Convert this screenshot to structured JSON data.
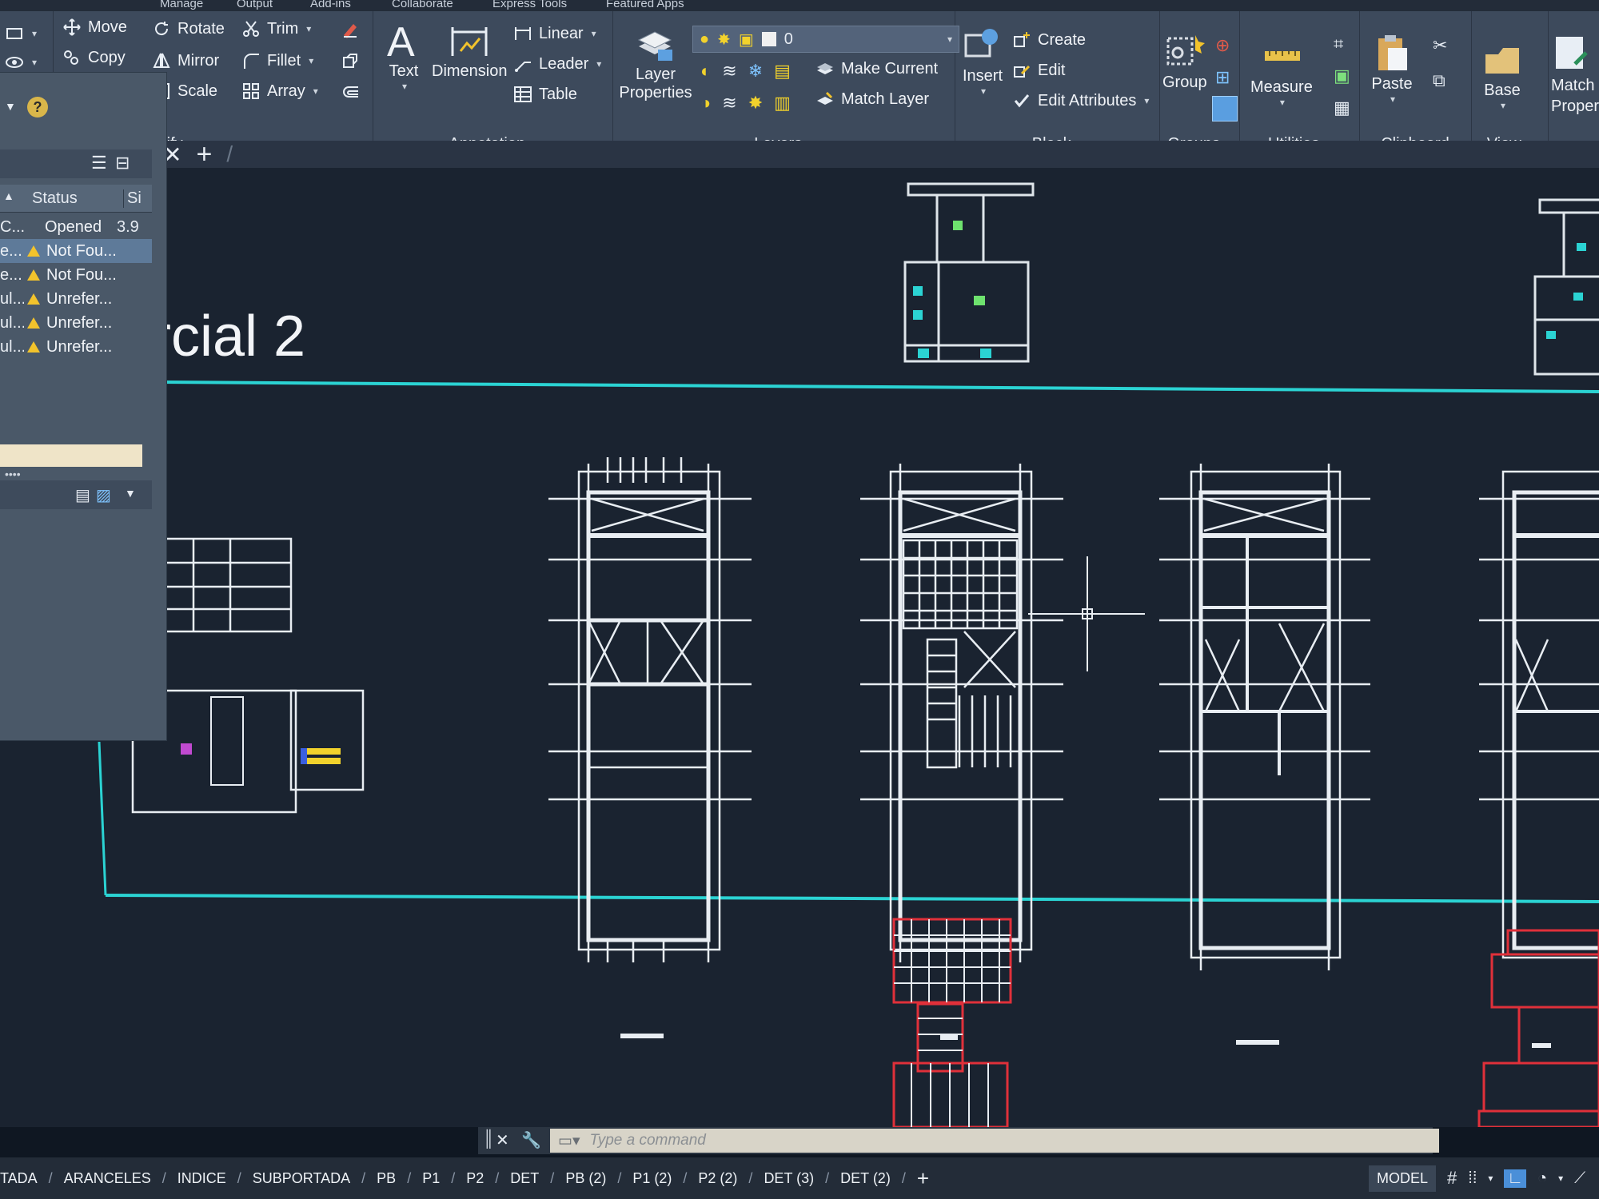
{
  "menu_strip": [
    "Manage",
    "Output",
    "Add-ins",
    "Collaborate",
    "Express Tools",
    "Featured Apps"
  ],
  "ribbon": {
    "modify": {
      "title": "Modify",
      "tools": [
        "Move",
        "Rotate",
        "Trim",
        "Copy",
        "Mirror",
        "Fillet",
        "Scale",
        "Array"
      ]
    },
    "annotation": {
      "title": "Annotation",
      "big": [
        "Text",
        "Dimension"
      ],
      "tools": [
        "Linear",
        "Leader",
        "Table"
      ]
    },
    "layers": {
      "title": "Layers",
      "big": "Layer Properties",
      "current_layer": "0",
      "tools": [
        "Make Current",
        "Match Layer"
      ]
    },
    "block": {
      "title": "Block",
      "big": "Insert",
      "tools": [
        "Create",
        "Edit",
        "Edit Attributes"
      ]
    },
    "groups": {
      "title": "Groups",
      "big": "Group"
    },
    "utilities": {
      "title": "Utilities",
      "big": "Measure"
    },
    "clipboard": {
      "title": "Clipboard",
      "big": "Paste"
    },
    "view": {
      "title": "View",
      "big": "Base"
    },
    "properties": {
      "big": "Match Proper"
    }
  },
  "xref_palette": {
    "columns": [
      "Status",
      "Si"
    ],
    "rows": [
      {
        "name": "C...",
        "status": "Opened",
        "size": "3.9",
        "warn": false
      },
      {
        "name": "e...",
        "status": "Not Fou...",
        "size": "",
        "warn": true
      },
      {
        "name": "e...",
        "status": "Not Fou...",
        "size": "",
        "warn": true
      },
      {
        "name": "ul...",
        "status": "Unrefer...",
        "size": "",
        "warn": true
      },
      {
        "name": "ul...",
        "status": "Unrefer...",
        "size": "",
        "warn": true
      },
      {
        "name": "ul...",
        "status": "Unrefer...",
        "size": "",
        "warn": true
      }
    ]
  },
  "sheet_title": "rcial 2",
  "command_placeholder": "Type a command",
  "layout_tabs": [
    "TADA",
    "ARANCELES",
    "INDICE",
    "SUBPORTADA",
    "PB",
    "P1",
    "P2",
    "DET",
    "PB (2)",
    "P1 (2)",
    "P2 (2)",
    "DET (3)",
    "DET (2)"
  ],
  "status": {
    "model_label": "MODEL"
  },
  "colors": {
    "accent_cyan": "#2bd3d3",
    "ribbon": "#3d4a5c",
    "canvas": "#1a2330",
    "red_geometry": "#e0303a"
  }
}
